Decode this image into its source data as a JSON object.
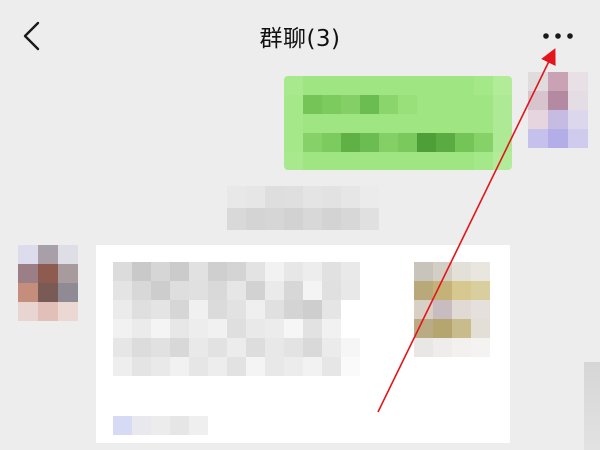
{
  "header": {
    "title": "群聊(3)",
    "back_icon": "chevron-left-icon",
    "more_icon": "more-dots-icon"
  },
  "colors": {
    "background": "#ededed",
    "sent_bubble": "#95ec69",
    "card_background": "#ffffff",
    "annotation_arrow": "#e3151a"
  },
  "pixelation": {
    "sent_bubble": [
      [
        "#a9e98d",
        "#9fe682",
        "#9fe682",
        "#9fe682",
        "#9fe682",
        "#9fe682",
        "#9fe682",
        "#9fe682",
        "#9fe682",
        "#9fe682",
        "#a5e889",
        "#b2ec99"
      ],
      [
        "#a5e889",
        "#74c458",
        "#7ccb5f",
        "#84d067",
        "#6cbd51",
        "#8bd56d",
        "#99e07b",
        "#9fe682",
        "#9fe682",
        "#9fe682",
        "#9fe682",
        "#aee995"
      ],
      [
        "#a5e889",
        "#9fe682",
        "#9fe682",
        "#9fe682",
        "#9fe682",
        "#9fe682",
        "#9fe682",
        "#9fe682",
        "#9fe682",
        "#9fe682",
        "#9fe682",
        "#aee995"
      ],
      [
        "#a5e889",
        "#86d168",
        "#7ccb5f",
        "#5fb146",
        "#6cbd51",
        "#84d067",
        "#79c95c",
        "#4f9f39",
        "#5aab41",
        "#74c458",
        "#86d168",
        "#aee995"
      ],
      [
        "#a9e98d",
        "#9fe682",
        "#9fe682",
        "#9fe682",
        "#9fe682",
        "#9fe682",
        "#9fe682",
        "#9fe682",
        "#9fe682",
        "#9fe682",
        "#a5e889",
        "#b2ec99"
      ]
    ],
    "avatar_right": [
      [
        "#e0dcde",
        "#c9a3b4",
        "#e8e0e4"
      ],
      [
        "#d8c4cc",
        "#b48aa2",
        "#e4dde4"
      ],
      [
        "#e6d5de",
        "#c6bbe3",
        "#dcd7ec"
      ],
      [
        "#c5c0ec",
        "#b3aee8",
        "#cfcbef"
      ]
    ],
    "system_message": [
      [
        "#e8e8e8",
        "#e6e6e6",
        "#dedede",
        "#dfdfdf",
        "#e4e4e4",
        "#e2e2e2",
        "#e6e6e6",
        "#ebebeb"
      ],
      [
        "#d9d9d9",
        "#d4d4d4",
        "#d6d6d6",
        "#d2d2d2",
        "#d8d8d8",
        "#d3d3d3",
        "#d7d7d7",
        "#e0e0e0"
      ]
    ],
    "avatar_left": [
      [
        "#dcdcec",
        "#a89fa8",
        "#dedee6"
      ],
      [
        "#9c7e86",
        "#8e5b50",
        "#a89b9e"
      ],
      [
        "#c48d7c",
        "#7a5a54",
        "#8f8a94"
      ],
      [
        "#e8d4d0",
        "#e2bfb8",
        "#ecd8d2"
      ]
    ],
    "card_text": [
      [
        "#dcdcdc",
        "#c9c9c9",
        "#d6d6d6",
        "#cbcbcb",
        "#e1e1e1",
        "#cfcfcf",
        "#d4d4d4",
        "#e3e3e3",
        "#f2f2f2",
        "#e7e7e7",
        "#ededed",
        "#e1e1e1",
        "#e9e9e9",
        "#ffffff",
        "#ffffff"
      ],
      [
        "#e4e4e4",
        "#d8d8d8",
        "#cdcdcd",
        "#dedede",
        "#e0e0e0",
        "#d9d9d9",
        "#e6e6e6",
        "#d2d2d2",
        "#eaeaea",
        "#d7d7d7",
        "#f4f4f4",
        "#e0e0e0",
        "#e8e8e8",
        "#ffffff",
        "#ffffff"
      ],
      [
        "#ebebeb",
        "#dfdfdf",
        "#e4e4e4",
        "#d6d6d6",
        "#f0f0f0",
        "#dbdbdb",
        "#e2e2e2",
        "#efefef",
        "#e0e0e0",
        "#d4d4d4",
        "#cecece",
        "#e5e5e5",
        "#ffffff",
        "#ffffff",
        "#ffffff"
      ],
      [
        "#f1f1f1",
        "#ebebeb",
        "#f4f4f4",
        "#e7e7e7",
        "#ededed",
        "#f1f1f1",
        "#dfdfdf",
        "#e9e9e9",
        "#ececec",
        "#f6f6f6",
        "#e2e2e2",
        "#f1f1f1",
        "#ffffff",
        "#ffffff",
        "#ffffff"
      ],
      [
        "#e6e6e6",
        "#dcdcdc",
        "#e1e1e1",
        "#d8d8d8",
        "#e9e9e9",
        "#e2e2e2",
        "#ececec",
        "#dddddd",
        "#e8e8e8",
        "#e3e3e3",
        "#d9d9d9",
        "#ebebeb",
        "#f6f6f6",
        "#ffffff",
        "#ffffff"
      ],
      [
        "#eeeeee",
        "#e4e4e4",
        "#e9e9e9",
        "#f1f1f1",
        "#e6e6e6",
        "#ededed",
        "#e2e2e2",
        "#f4f4f4",
        "#e8e8e8",
        "#ececec",
        "#f2f2f2",
        "#e6e6e6",
        "#fafafa",
        "#ffffff",
        "#ffffff"
      ],
      [
        "#ffffff",
        "#ffffff",
        "#ffffff",
        "#ffffff",
        "#ffffff",
        "#ffffff",
        "#ffffff",
        "#ffffff",
        "#ffffff",
        "#ffffff",
        "#ffffff",
        "#ffffff",
        "#ffffff",
        "#ffffff",
        "#ffffff"
      ],
      [
        "#ffffff",
        "#ffffff",
        "#ffffff",
        "#ffffff",
        "#ffffff",
        "#ffffff",
        "#ffffff",
        "#ffffff",
        "#ffffff",
        "#ffffff",
        "#ffffff",
        "#ffffff",
        "#ffffff",
        "#ffffff",
        "#ffffff"
      ]
    ],
    "card_thumbnail": [
      [
        "#c9c4bb",
        "#d4cfc4",
        "#e3e0d8",
        "#e9e6e0"
      ],
      [
        "#b8a87a",
        "#c4b278",
        "#d6c88e",
        "#d9cf9e"
      ],
      [
        "#d8d0c4",
        "#c9bcc0",
        "#e1d9d4",
        "#e6e0dc"
      ],
      [
        "#b9ab84",
        "#b5a56e",
        "#c8bb8c",
        "#e4dfd6"
      ],
      [
        "#e9e7e4",
        "#efedeb",
        "#f2f1ef",
        "#f4f3f2"
      ]
    ],
    "card_source": [
      [
        "#d6daf4",
        "#e8e8ee",
        "#ececec",
        "#e6e6e6",
        "#efefef"
      ]
    ]
  }
}
